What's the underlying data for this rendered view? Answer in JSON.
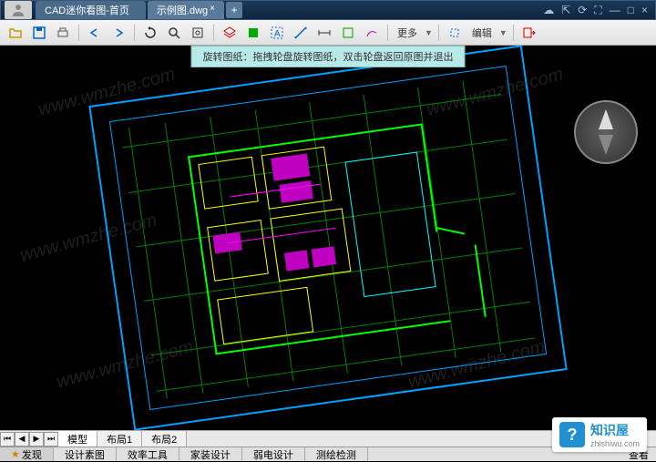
{
  "titlebar": {
    "tabs": [
      {
        "label": "CAD迷你看图-首页"
      },
      {
        "label": "示例图.dwg"
      }
    ]
  },
  "toolbar": {
    "more_label": "更多",
    "edit_label": "编辑"
  },
  "hint": "旋转图纸：拖拽轮盘旋转图纸，双击轮盘返回原图并退出",
  "layout_tabs": [
    "模型",
    "布局1",
    "布局2"
  ],
  "bottom_tabs": [
    "发现",
    "设计素图",
    "效率工具",
    "家装设计",
    "弱电设计",
    "测绘检测"
  ],
  "bottom_right": "查看",
  "watermark": "www.wmzhe.com",
  "logo": {
    "cn": "知识屋",
    "en": "zhishiwu.com",
    "glyph": "?"
  }
}
